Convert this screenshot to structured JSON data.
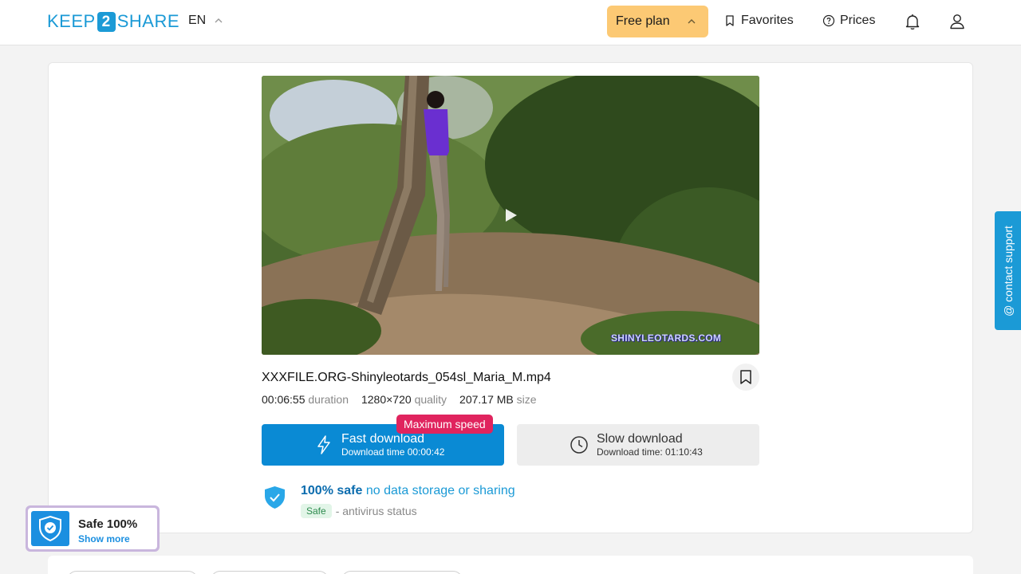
{
  "header": {
    "logo": {
      "left": "KEEP",
      "number": "2",
      "right": "SHARE"
    },
    "language": "EN",
    "plan_label": "Free plan",
    "favorites_label": "Favorites",
    "prices_label": "Prices"
  },
  "file": {
    "video_watermark": "SHINYLEOTARDS.COM",
    "name": "XXXFILE.ORG-Shinyleotards_054sl_Maria_M.mp4",
    "duration": "00:06:55",
    "duration_unit": "duration",
    "quality": "1280×720",
    "quality_unit": "quality",
    "size": "207.17 MB",
    "size_unit": "size"
  },
  "download": {
    "badge": "Maximum speed",
    "fast_label": "Fast download",
    "fast_sub": "Download time 00:00:42",
    "slow_label": "Slow download",
    "slow_sub": "Download time: 01:10:43"
  },
  "safety": {
    "headline_strong": "100% safe",
    "headline_light": "no data storage or sharing",
    "status_badge": "Safe",
    "status_text": "- antivirus status"
  },
  "support_tab": "@ contact support",
  "safe_widget": {
    "title": "Safe 100%",
    "link": "Show more"
  },
  "colors": {
    "brand": "#1b9ad6",
    "plan_button": "#fcc974",
    "fast_button": "#0a8ad4",
    "speed_badge": "#e0245e",
    "safe_badge_bg": "#e2f5e8"
  }
}
